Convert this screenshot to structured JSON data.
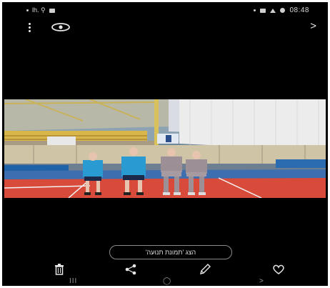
{
  "status_bar": {
    "time": "08:48",
    "left_glyphs": "lh. ⚲"
  },
  "top_bar": {
    "menu_icon": "vertical-dots-icon",
    "view_icon": "eye-icon",
    "next_icon": "chevron-right-icon",
    "next_glyph": ">"
  },
  "photo": {
    "description_icon": "sports-hall-photo"
  },
  "action_pill": {
    "label": "הצג 'תמונת תנועה'"
  },
  "bottom_actions": {
    "delete_icon": "trash-icon",
    "share_icon": "share-icon",
    "edit_icon": "pencil-icon",
    "favorite_icon": "heart-icon"
  },
  "nav_bar": {
    "recents": "III",
    "home": "◯",
    "back": ">"
  },
  "colors": {
    "background": "#000000",
    "floor_red": "#d84a3a",
    "floor_blue": "#3d6fb0",
    "shirt_blue": "#2a9ad2",
    "jacket_grey": "#9c8f95"
  }
}
